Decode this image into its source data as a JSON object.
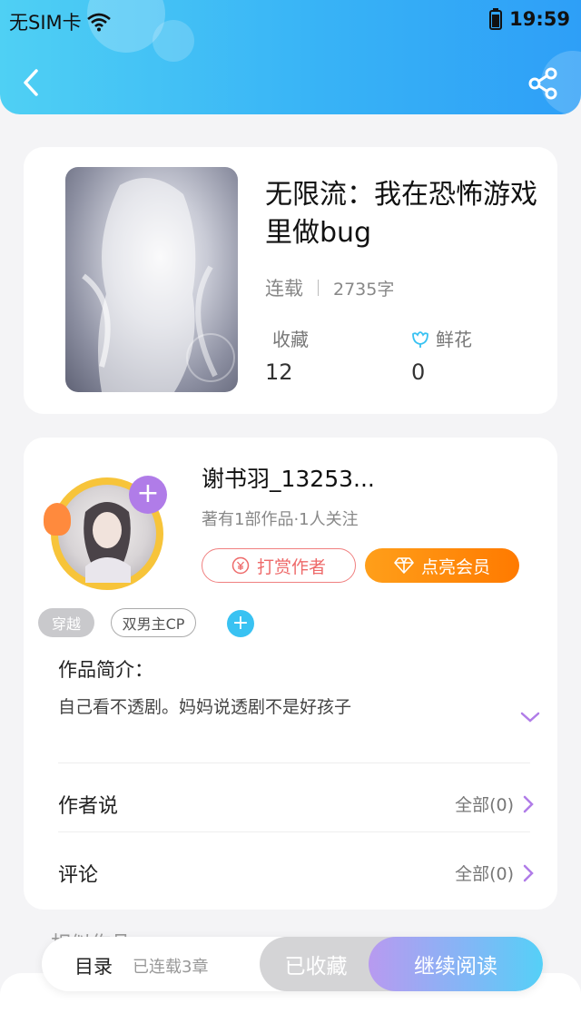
{
  "status_bar": {
    "carrier": "无SIM卡",
    "time": "19:59"
  },
  "book": {
    "title": "无限流：我在恐怖游戏里做bug",
    "status": "连载",
    "word_count": "2735字",
    "favorites_label": "收藏",
    "favorites_count": "12",
    "flowers_label": "鲜花",
    "flowers_count": "0"
  },
  "author": {
    "name": "谢书羽_13253...",
    "meta": "著有1部作品·1人关注",
    "tip_label": "打赏作者",
    "vip_label": "点亮会员"
  },
  "tags": [
    "穿越",
    "双男主CP"
  ],
  "intro": {
    "title": "作品简介：",
    "text": "自己看不透剧。妈妈说透剧不是好孩子"
  },
  "author_says": {
    "label": "作者说",
    "all_label": "全部(0)"
  },
  "comments": {
    "label": "评论",
    "all_label": "全部(0)"
  },
  "bottom_bar": {
    "toc_label": "目录",
    "chapters": "已连载3章",
    "collected_label": "已收藏",
    "continue_label": "继续阅读"
  },
  "peek_section_title": "相似作品",
  "colors": {
    "header": "#38b3f6",
    "accent_purple": "#b07ce8",
    "vip_orange": "#ff8a00",
    "tip_red": "#ee6a6a"
  }
}
